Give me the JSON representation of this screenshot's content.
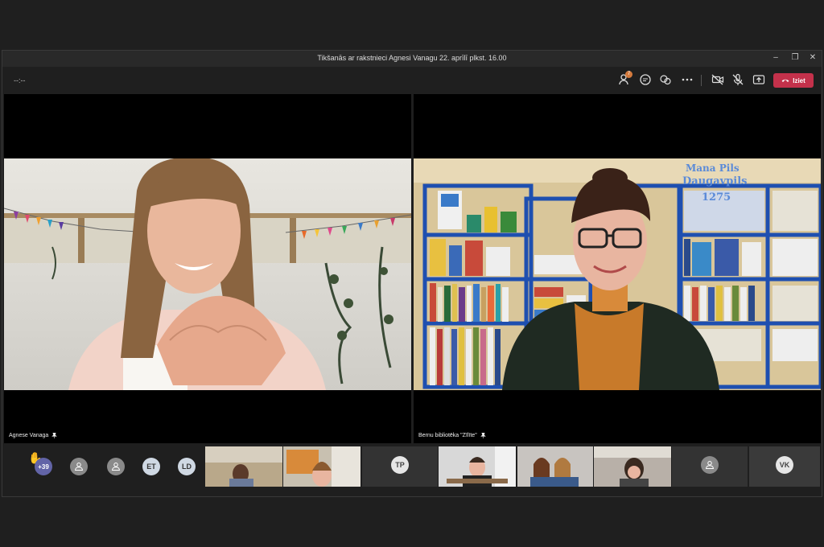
{
  "window": {
    "title": "Tikšanās ar rakstnieci Agnesi Vanagu 22. aprīlī plkst. 16.00",
    "min": "–",
    "max": "❐",
    "close": "✕"
  },
  "toolbar": {
    "timer": "--:--",
    "participants_badge": "7",
    "leave_label": "Iziet"
  },
  "stage": {
    "left_name": "Agnese Vanaga",
    "right_name": "Bernu bibliotēka \"Zīlīte\""
  },
  "strip": {
    "raised_count": "+39",
    "avatars": [
      "ET",
      "LD",
      "TP",
      "VK"
    ]
  },
  "colors": {
    "leave": "#c4314b",
    "accent": "#6264a7"
  }
}
